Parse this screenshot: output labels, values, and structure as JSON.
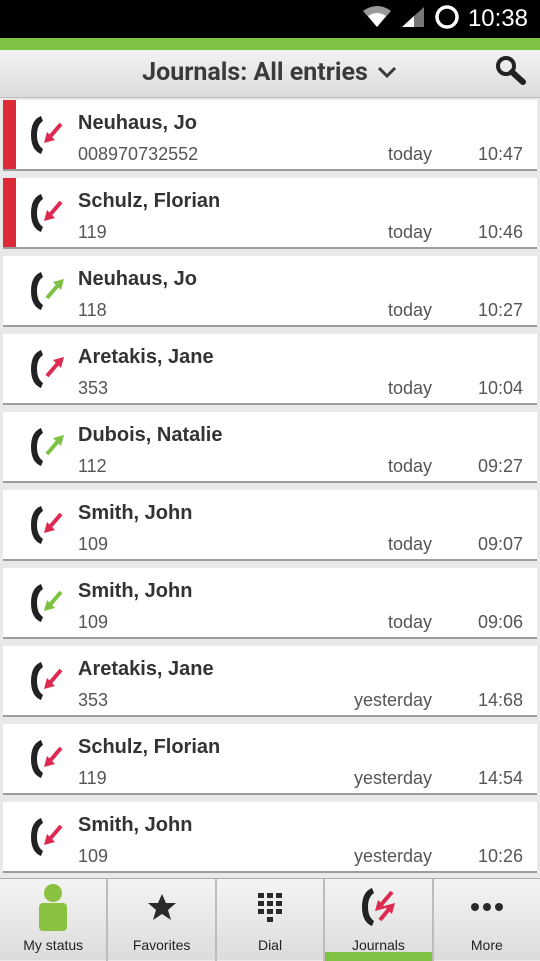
{
  "status_bar": {
    "time": "10:38"
  },
  "header": {
    "title": "Journals: All entries"
  },
  "entries": [
    {
      "name": "Neuhaus, Jo",
      "number": "008970732552",
      "day": "today",
      "time": "10:47",
      "type": "missed"
    },
    {
      "name": "Schulz, Florian",
      "number": "119",
      "day": "today",
      "time": "10:46",
      "type": "missed"
    },
    {
      "name": "Neuhaus, Jo",
      "number": "118",
      "day": "today",
      "time": "10:27",
      "type": "outgoing"
    },
    {
      "name": "Aretakis, Jane",
      "number": "353",
      "day": "today",
      "time": "10:04",
      "type": "outgoing-red"
    },
    {
      "name": "Dubois, Natalie",
      "number": "112",
      "day": "today",
      "time": "09:27",
      "type": "outgoing"
    },
    {
      "name": "Smith, John",
      "number": "109",
      "day": "today",
      "time": "09:07",
      "type": "incoming-red"
    },
    {
      "name": "Smith, John",
      "number": "109",
      "day": "today",
      "time": "09:06",
      "type": "incoming-green"
    },
    {
      "name": "Aretakis, Jane",
      "number": "353",
      "day": "yesterday",
      "time": "14:68",
      "type": "incoming-red"
    },
    {
      "name": "Schulz, Florian",
      "number": "119",
      "day": "yesterday",
      "time": "14:54",
      "type": "incoming-red"
    },
    {
      "name": "Smith, John",
      "number": "109",
      "day": "yesterday",
      "time": "10:26",
      "type": "incoming-red"
    }
  ],
  "bottom_nav": [
    {
      "label": "My status",
      "icon": "person-icon"
    },
    {
      "label": "Favorites",
      "icon": "star-icon"
    },
    {
      "label": "Dial",
      "icon": "dialpad-icon"
    },
    {
      "label": "Journals",
      "icon": "journals-icon",
      "active": true
    },
    {
      "label": "More",
      "icon": "more-icon"
    }
  ],
  "colors": {
    "accent": "#7dc242",
    "missed": "#dc2a38",
    "incoming_red": "#dc2a50",
    "outgoing_green": "#7dc242"
  }
}
